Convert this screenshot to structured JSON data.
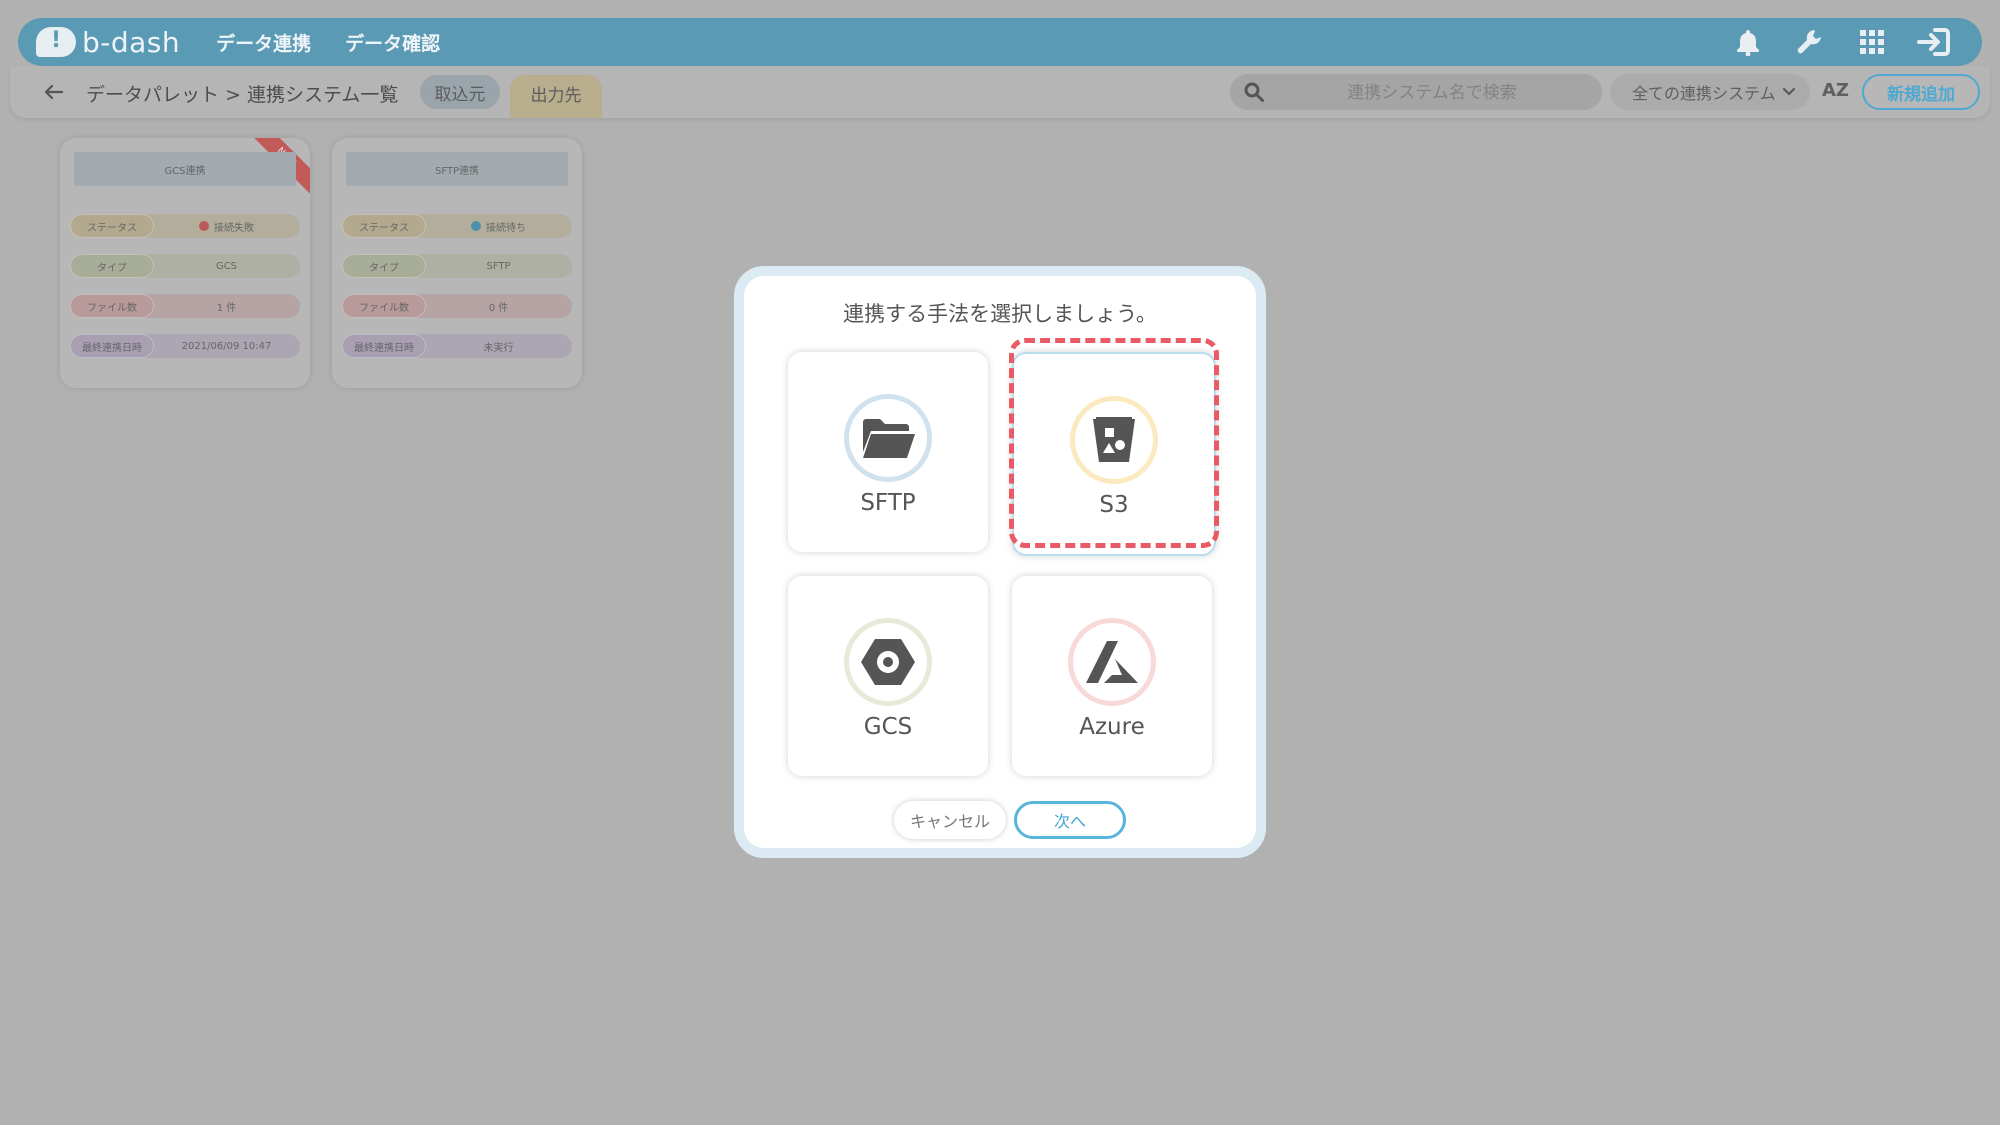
{
  "app": {
    "logo_text": "b-dash"
  },
  "nav": {
    "items": [
      "データ連携",
      "データ確認"
    ]
  },
  "topbar_icons": [
    "bell-icon",
    "wrench-icon",
    "grid-icon",
    "sign-in-icon"
  ],
  "subbar": {
    "breadcrumb": "データパレット > 連携システム一覧",
    "tab_in": "取込元",
    "tab_out": "出力先",
    "search_placeholder": "連携システム名で検索",
    "filter_selected": "全ての連携システム",
    "sort_label": "AZ",
    "add_button": "新規追加"
  },
  "cards": [
    {
      "title": "GCS連携",
      "badge": "NEW",
      "rows": [
        {
          "key": "ステータス",
          "value": "接続失敗",
          "status_color": "#b85a5a"
        },
        {
          "key": "タイプ",
          "value": "GCS"
        },
        {
          "key": "ファイル数",
          "value": "1 件"
        },
        {
          "key": "最終連携日時",
          "value": "2021/06/09 10:47"
        }
      ]
    },
    {
      "title": "SFTP連携",
      "badge": "",
      "rows": [
        {
          "key": "ステータス",
          "value": "接続待ち",
          "status_color": "#4f90ad"
        },
        {
          "key": "タイプ",
          "value": "SFTP"
        },
        {
          "key": "ファイル数",
          "value": "0 件"
        },
        {
          "key": "最終連携日時",
          "value": "未実行"
        }
      ]
    }
  ],
  "colors": {
    "status_key": "#b2a98e",
    "type_key": "#a8ad97",
    "files_key": "#b89a9a",
    "date_key": "#a89fb1"
  },
  "modal": {
    "heading": "連携する手法を選択しましょう。",
    "options": [
      {
        "label": "SFTP",
        "icon": "folder-open-icon",
        "ring_color": "#cfe2ee"
      },
      {
        "label": "S3",
        "icon": "bucket-icon",
        "ring_color": "#fbeac0",
        "selected": true
      },
      {
        "label": "GCS",
        "icon": "hexagon-icon",
        "ring_color": "#e6ead8"
      },
      {
        "label": "Azure",
        "icon": "azure-icon",
        "ring_color": "#f8d8d8"
      }
    ],
    "cancel_button": "キャンセル",
    "next_button": "次へ"
  }
}
